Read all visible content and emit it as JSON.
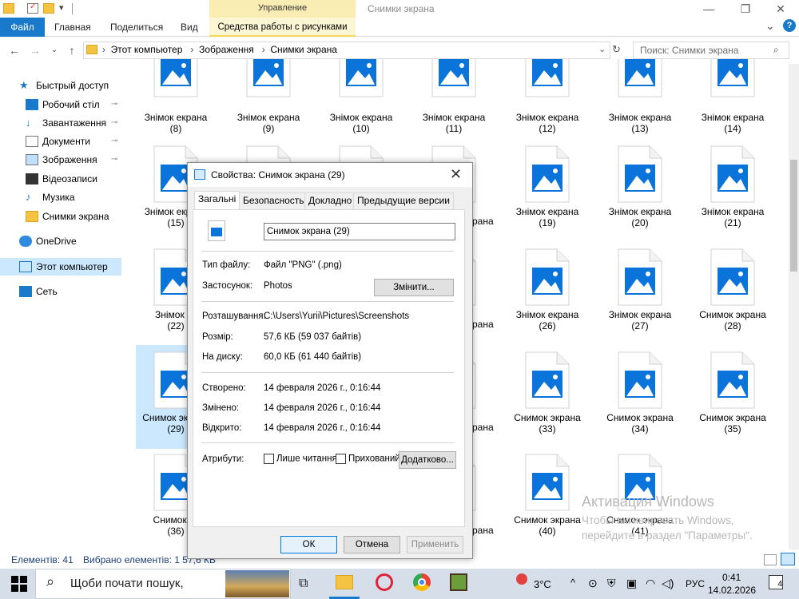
{
  "window": {
    "title": "Снимки экрана",
    "manage_tab": "Управление",
    "picture_tools_tab": "Средства работы с рисунками",
    "minimize": "—",
    "maximize": "❐",
    "close": "✕"
  },
  "ribbon": {
    "tabs": [
      "Файл",
      "Главная",
      "Поделиться",
      "Вид"
    ],
    "collapse": "⌄",
    "help": "?"
  },
  "address": {
    "crumbs": [
      "Этот компьютер",
      "Зображення",
      "Снимки экрана"
    ],
    "search_placeholder": "Поиск: Снимки экрана"
  },
  "nav_pane": {
    "items": [
      {
        "label": "Быстрый доступ",
        "icon": "star-icon"
      },
      {
        "label": "Робочий стіл",
        "icon": "desktop-icon",
        "pinned": true
      },
      {
        "label": "Завантаження",
        "icon": "download-icon",
        "pinned": true
      },
      {
        "label": "Документи",
        "icon": "documents-icon",
        "pinned": true
      },
      {
        "label": "Зображення",
        "icon": "pictures-icon",
        "pinned": true
      },
      {
        "label": "Відеозаписи",
        "icon": "video-icon"
      },
      {
        "label": "Музика",
        "icon": "music-icon"
      },
      {
        "label": "Снимки экрана",
        "icon": "folder-icon"
      },
      {
        "label": "OneDrive",
        "icon": "cloud-icon"
      },
      {
        "label": "Этот компьютер",
        "icon": "computer-icon",
        "selected": true
      },
      {
        "label": "Сеть",
        "icon": "network-icon"
      }
    ]
  },
  "files": [
    {
      "name": "Знімок екрана",
      "num": "(8)"
    },
    {
      "name": "Знімок екрана",
      "num": "(9)"
    },
    {
      "name": "Знімок екрана",
      "num": "(10)"
    },
    {
      "name": "Знімок екрана",
      "num": "(11)"
    },
    {
      "name": "Знімок екрана",
      "num": "(12)"
    },
    {
      "name": "Знімок екрана",
      "num": "(13)"
    },
    {
      "name": "Знімок екрана",
      "num": "(14)"
    },
    {
      "name": "Знімок екрана",
      "num": "(15)"
    },
    {
      "name": "",
      "num": ""
    },
    {
      "name": "",
      "num": ""
    },
    {
      "name": "",
      "num": ""
    },
    {
      "name": "Знімок екрана",
      "num": "(19)"
    },
    {
      "name": "Знімок екрана",
      "num": "(20)"
    },
    {
      "name": "Знімок екрана",
      "num": "(21)"
    },
    {
      "name": "Знімок ек",
      "num": "(22)"
    },
    {
      "name": "",
      "num": ""
    },
    {
      "name": "",
      "num": ""
    },
    {
      "name": "",
      "num": ""
    },
    {
      "name": "Знімок екрана",
      "num": "(26)"
    },
    {
      "name": "Знімок екрана",
      "num": "(27)"
    },
    {
      "name": "Снимок экрана",
      "num": "(28)"
    },
    {
      "name": "Снимок экрана",
      "num": "(29)",
      "selected": true
    },
    {
      "name": "",
      "num": ""
    },
    {
      "name": "",
      "num": ""
    },
    {
      "name": "",
      "num": ""
    },
    {
      "name": "Снимок экрана",
      "num": "(33)"
    },
    {
      "name": "Снимок экрана",
      "num": "(34)"
    },
    {
      "name": "Снимок экрана",
      "num": "(35)"
    },
    {
      "name": "Снимок эк",
      "num": "(36)"
    },
    {
      "name": "",
      "num": ""
    },
    {
      "name": "",
      "num": ""
    },
    {
      "name": "",
      "num": ""
    },
    {
      "name": "Снимок экрана",
      "num": "(40)"
    },
    {
      "name": "Снимок экрана",
      "num": "(41)"
    }
  ],
  "partial_labels": [
    "рана",
    "рана",
    "рана",
    "рана",
    "рана"
  ],
  "status": {
    "count": "Елементів: 41",
    "selected": "Вибрано елементів: 1  57,6 КБ"
  },
  "watermark": {
    "title": "Активация Windows",
    "line1": "Чтобы активировать Windows,",
    "line2": "перейдите в раздел \"Параметры\"."
  },
  "dialog": {
    "title": "Свойства: Снимок экрана (29)",
    "tabs": [
      "Загальні",
      "Безопасность",
      "Докладно",
      "Предыдущие версии"
    ],
    "filename": "Снимок экрана (29)",
    "file_type_label": "Тип файлу:",
    "file_type_value": "Файл \"PNG\" (.png)",
    "app_label": "Застосунок:",
    "app_value": "Photos",
    "change_button": "Змінити...",
    "location_label": "Розташування:",
    "location_value": "C:\\Users\\Yurii\\Pictures\\Screenshots",
    "size_label": "Розмір:",
    "size_value": "57,6 КБ (59 037 байтів)",
    "disk_label": "На диску:",
    "disk_value": "60,0 КБ (61 440 байтів)",
    "created_label": "Створено:",
    "created_value": "14 февраля 2026 г., 0:16:44",
    "modified_label": "Змінено:",
    "modified_value": "14 февраля 2026 г., 0:16:44",
    "accessed_label": "Відкрито:",
    "accessed_value": "14 февраля 2026 г., 0:16:44",
    "attributes_label": "Атрибути:",
    "readonly_label": "Лише читання",
    "hidden_label": "Прихований",
    "advanced_button": "Додатково...",
    "ok_button": "ОК",
    "cancel_button": "Отмена",
    "apply_button": "Применить"
  },
  "taskbar": {
    "search_placeholder": "Щоби почати пошук,",
    "weather": "3°C",
    "language": "РУС",
    "time": "0:41",
    "date": "14.02.2026",
    "notifications": "4"
  },
  "colors": {
    "accent": "#1979ca",
    "image_icon_blue": "#0a74da",
    "selection": "#cce8ff",
    "manage_tab": "#faedb4"
  }
}
